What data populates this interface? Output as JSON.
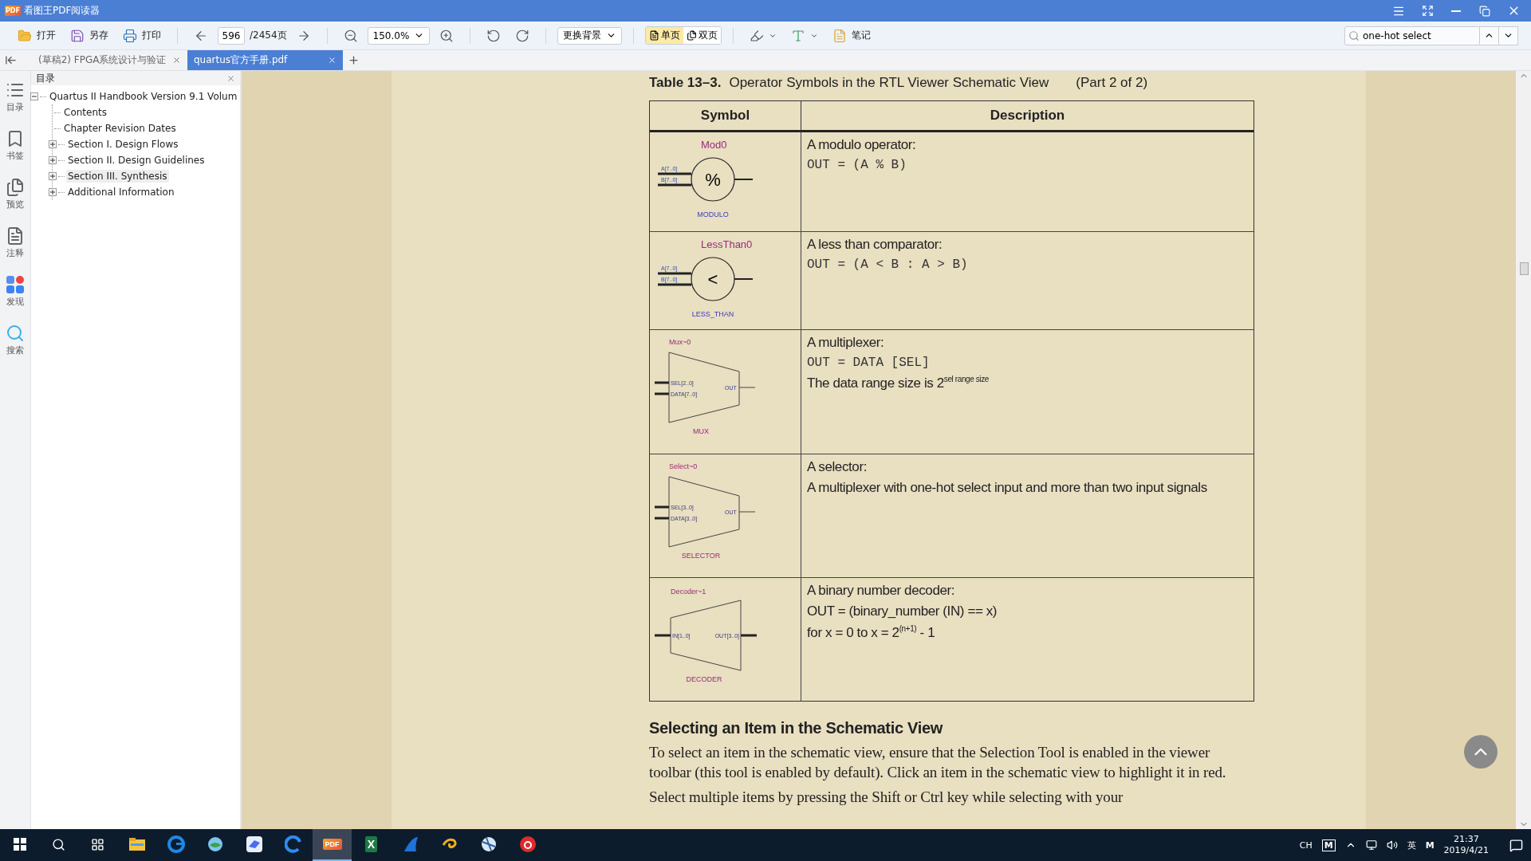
{
  "window": {
    "logo": "PDF",
    "title": "看图王PDF阅读器"
  },
  "toolbar": {
    "open": "打开",
    "save_as": "另存",
    "print": "打印",
    "page_current": "596",
    "page_total": "/2454页",
    "zoom": "150.0%",
    "background": "更换背景",
    "view_modes": [
      {
        "label": "单页",
        "selected": true
      },
      {
        "label": "双页",
        "selected": false
      }
    ],
    "notes": "笔记",
    "search": {
      "value": "one-hot select"
    }
  },
  "tabs": [
    {
      "label": "(草稿2) FPGA系统设计与验证",
      "selected": false
    },
    {
      "label": "quartus官方手册.pdf",
      "selected": true
    }
  ],
  "rail": [
    {
      "kind": "toc",
      "label": "目录"
    },
    {
      "kind": "bookmark",
      "label": "书签"
    },
    {
      "kind": "preview",
      "label": "预览"
    },
    {
      "kind": "notes",
      "label": "注释"
    },
    {
      "kind": "discover",
      "label": "发现"
    },
    {
      "kind": "search",
      "label": "搜索"
    }
  ],
  "outline": {
    "title": "目录",
    "items": [
      {
        "label": "Quartus II Handbook Version 9.1 Volum",
        "expanded": true,
        "selected": false,
        "children": [
          {
            "label": "Contents",
            "selected": false
          },
          {
            "label": "Chapter Revision Dates",
            "selected": false
          },
          {
            "label": "Section I. Design Flows",
            "expanded": false,
            "selected": false
          },
          {
            "label": "Section II. Design Guidelines",
            "expanded": false,
            "selected": false
          },
          {
            "label": "Section III. Synthesis",
            "expanded": false,
            "selected": true
          },
          {
            "label": "Additional Information",
            "expanded": false,
            "selected": false
          }
        ]
      }
    ]
  },
  "document": {
    "table_number": "Table 13–3.",
    "table_title": "Operator Symbols in the RTL Viewer Schematic View",
    "table_part": "(Part 2 of 2)",
    "columns": [
      "Symbol",
      "Description"
    ],
    "rows": [
      {
        "symbol": {
          "kind": "circle",
          "name": "Mod0",
          "operator": "%",
          "inputs": [
            "A[7..0]",
            "B[7..0]"
          ],
          "type": "MODULO"
        },
        "lines": [
          {
            "kind": "text",
            "text": "A modulo operator:"
          },
          {
            "kind": "code",
            "text": "OUT = (A % B)"
          }
        ]
      },
      {
        "symbol": {
          "kind": "circle",
          "name": "LessThan0",
          "operator": "<",
          "inputs": [
            "A[7..0]",
            "B[7..0]"
          ],
          "type": "LESS_THAN"
        },
        "lines": [
          {
            "kind": "text",
            "text": "A less than comparator:"
          },
          {
            "kind": "code",
            "text": "OUT = (A < B : A > B)"
          }
        ]
      },
      {
        "symbol": {
          "kind": "mux",
          "name": "Mux~0",
          "inputs": [
            "SEL[2..0]",
            "DATA[7..0]"
          ],
          "output": "OUT",
          "type": "MUX"
        },
        "lines": [
          {
            "kind": "text",
            "text": "A multiplexer:"
          },
          {
            "kind": "code",
            "text": "OUT = DATA [SEL]"
          },
          {
            "kind": "text",
            "text": "The data range size is 2$^{sel range size}$"
          }
        ]
      },
      {
        "symbol": {
          "kind": "mux",
          "name": "Select~0",
          "inputs": [
            "SEL[3..0]",
            "DATA[3..0]"
          ],
          "output": "OUT",
          "type": "SELECTOR"
        },
        "lines": [
          {
            "kind": "text",
            "text": "A selector:"
          },
          {
            "kind": "text",
            "text": "A multiplexer with one-hot select input and more than two input signals"
          }
        ]
      },
      {
        "symbol": {
          "kind": "decoder",
          "name": "Decoder~1",
          "inputs": [
            "IN[1..0]"
          ],
          "output": "OUT[3..0]",
          "type": "DECODER"
        },
        "lines": [
          {
            "kind": "text",
            "text": "A binary number decoder:"
          },
          {
            "kind": "text",
            "text": "OUT = (binary_number (IN) == x)"
          },
          {
            "kind": "text",
            "text": "for x = 0 to x = 2$^{(n+1)}$ - 1"
          }
        ]
      }
    ],
    "heading": "Selecting an Item in the Schematic View",
    "paragraphs": [
      "To select an item in the schematic view, ensure that the Selection Tool is enabled in the viewer toolbar (this tool is enabled by default). Click an item in the schematic view to highlight it in red.",
      "Select multiple items by pressing the Shift or Ctrl key while selecting with your"
    ]
  },
  "taskbar": {
    "apps": [
      {
        "kind": "explorer",
        "selected": false
      },
      {
        "kind": "edge",
        "selected": false
      },
      {
        "kind": "globe",
        "selected": false
      },
      {
        "kind": "bird",
        "selected": false
      },
      {
        "kind": "edge2",
        "selected": false
      },
      {
        "kind": "pdf",
        "label": "PDF",
        "selected": true
      },
      {
        "kind": "excel",
        "label": "X",
        "selected": false
      },
      {
        "kind": "sail",
        "selected": false
      },
      {
        "kind": "swirl",
        "selected": false
      },
      {
        "kind": "network",
        "selected": false
      },
      {
        "kind": "music",
        "selected": false
      }
    ],
    "tray": {
      "layout": "CH",
      "badge": "M",
      "ime": "英",
      "badge2": "M",
      "time": "21:37",
      "date": "2019/4/21"
    }
  }
}
